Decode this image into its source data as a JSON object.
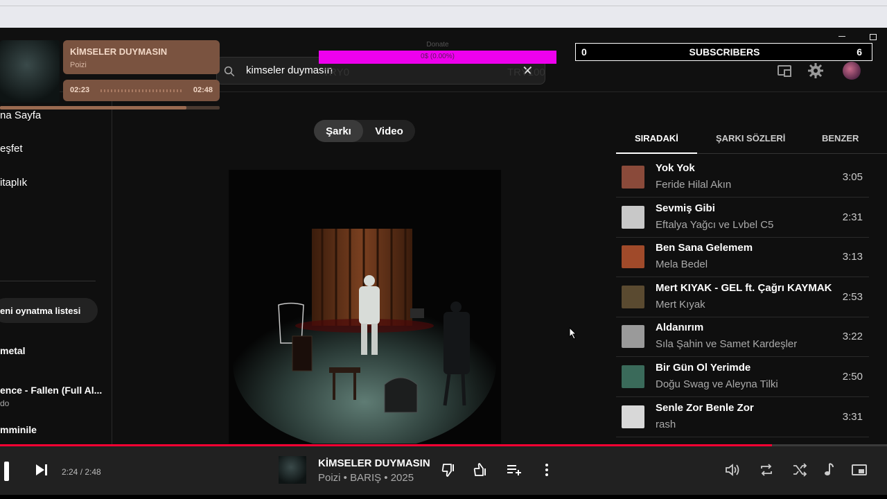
{
  "search": {
    "query": "kimseler duymasın"
  },
  "now_playing_overlay": {
    "title": "KİMSELER DUYMASIN",
    "artist": "Poizi",
    "elapsed": "02:23",
    "total": "02:48",
    "progress": 0.85
  },
  "donate": {
    "label": "Donate",
    "percent": "0$ (0.00%)",
    "min": "TRY0",
    "max": "TRY100"
  },
  "subscribers": {
    "left": "0",
    "label": "SUBSCRIBERS",
    "right": "6"
  },
  "sidebar": {
    "nav": [
      "na Sayfa",
      "eşfet",
      "itaplık"
    ],
    "new_playlist": "eni oynatma listesi",
    "playlists": [
      {
        "title": "metal",
        "subtitle": ""
      },
      {
        "title": "ence - Fallen (Full Al...",
        "subtitle": "do"
      },
      {
        "title": "mminile",
        "subtitle": ""
      }
    ]
  },
  "mode_tabs": {
    "song": "Şarkı",
    "video": "Video"
  },
  "right_tabs": [
    "SIRADAKİ",
    "ŞARKI SÖZLERİ",
    "BENZER"
  ],
  "queue": [
    {
      "title": "Yok Yok",
      "artist": "Feride Hilal Akın",
      "duration": "3:05",
      "color": "#8a4a3a"
    },
    {
      "title": "Sevmiş Gibi",
      "artist": "Eftalya Yağcı ve Lvbel C5",
      "duration": "2:31",
      "color": "#c8c8c8"
    },
    {
      "title": "Ben Sana Gelemem",
      "artist": "Mela Bedel",
      "duration": "3:13",
      "color": "#a04a2a"
    },
    {
      "title": "Mert KIYAK - GEL ft. Çağrı KAYMAK",
      "artist": "Mert Kıyak",
      "duration": "2:53",
      "color": "#5a4a30"
    },
    {
      "title": "Aldanırım",
      "artist": "Sıla Şahin ve Samet Kardeşler",
      "duration": "3:22",
      "color": "#9a9a9a"
    },
    {
      "title": "Bir Gün Ol Yerimde",
      "artist": "Doğu Swag ve Aleyna Tilki",
      "duration": "2:50",
      "color": "#3a6a5a"
    },
    {
      "title": "Senle Zor Benle Zor",
      "artist": "rash",
      "duration": "3:31",
      "color": "#d8d8d8"
    }
  ],
  "player": {
    "time": "2:24 / 2:48",
    "title": "KİMSELER DUYMASIN",
    "subtitle": "Poizi • BARIŞ • 2025",
    "progress": 0.87
  },
  "icons": [
    "search-icon",
    "close-icon",
    "cast-icon",
    "gear-icon",
    "next-icon",
    "dislike-icon",
    "like-icon",
    "add-to-queue-icon",
    "more-icon",
    "volume-icon",
    "repeat-icon",
    "shuffle-icon",
    "music-note-icon",
    "miniplayer-icon"
  ]
}
